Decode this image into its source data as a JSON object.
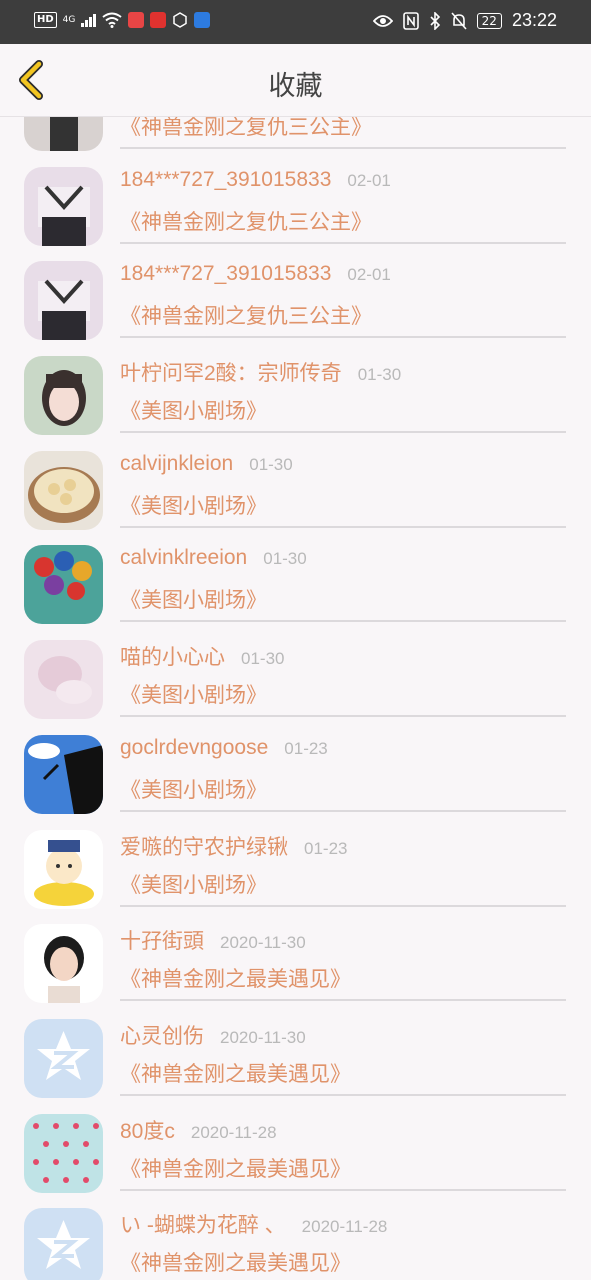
{
  "status_bar": {
    "hd_label": "HD",
    "network_label": "4G",
    "battery_level": "22",
    "time": "23:22"
  },
  "header": {
    "title": "收藏"
  },
  "items": [
    {
      "name": "",
      "date": "",
      "drama": "《神兽金刚之复仇三公主》",
      "avatar": "person-dark-avatar"
    },
    {
      "name": "184***727_391015833",
      "date": "02-01",
      "drama": "《神兽金刚之复仇三公主》",
      "avatar": "girl-uniform-avatar"
    },
    {
      "name": "184***727_391015833",
      "date": "02-01",
      "drama": "《神兽金刚之复仇三公主》",
      "avatar": "girl-uniform-avatar"
    },
    {
      "name": "叶柠问罕2酸：宗师传奇",
      "date": "01-30",
      "drama": "《美图小剧场》",
      "avatar": "girl-portrait-avatar"
    },
    {
      "name": "calvijnkleion",
      "date": "01-30",
      "drama": "《美图小剧场》",
      "avatar": "food-avatar"
    },
    {
      "name": "calvinklreeion",
      "date": "01-30",
      "drama": "《美图小剧场》",
      "avatar": "balloons-avatar"
    },
    {
      "name": "喵的小心心",
      "date": "01-30",
      "drama": "《美图小剧场》",
      "avatar": "pink-soft-avatar"
    },
    {
      "name": "goclrdevngoose",
      "date": "01-23",
      "drama": "《美图小剧场》",
      "avatar": "climber-avatar"
    },
    {
      "name": "爱嗾的守农护绿锹",
      "date": "01-23",
      "drama": "《美图小剧场》",
      "avatar": "cartoon-duck-avatar"
    },
    {
      "name": "十孖街頭",
      "date": "2020-11-30",
      "drama": "《神兽金刚之最美遇见》",
      "avatar": "short-hair-avatar"
    },
    {
      "name": "心灵创伤",
      "date": "2020-11-30",
      "drama": "《神兽金刚之最美遇见》",
      "avatar": "default-qq-avatar"
    },
    {
      "name": "80度c",
      "date": "2020-11-28",
      "drama": "《神兽金刚之最美遇见》",
      "avatar": "floral-pattern-avatar"
    },
    {
      "name": "い -蝴蝶为花醉 、",
      "date": "2020-11-28",
      "drama": "《神兽金刚之最美遇见》",
      "avatar": "default-qq-avatar"
    }
  ]
}
